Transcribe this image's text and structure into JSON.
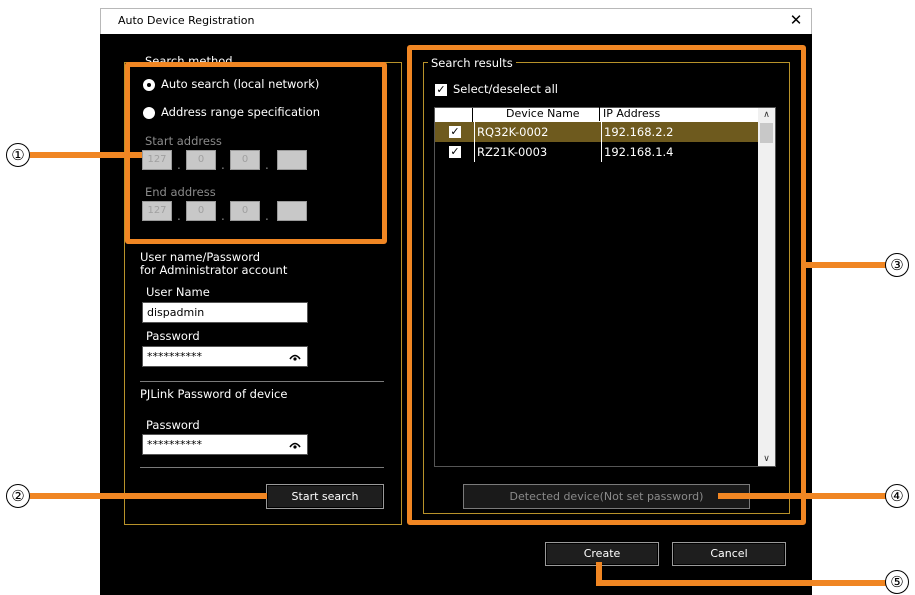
{
  "window": {
    "title": "Auto Device Registration",
    "close_glyph": "✕"
  },
  "search_method": {
    "group_label": "Search method",
    "option_auto": "Auto search (local network)",
    "option_range": "Address range specification",
    "start_label": "Start address",
    "end_label": "End address",
    "start_ip": [
      "127",
      "0",
      "0",
      ""
    ],
    "end_ip": [
      "127",
      "0",
      "0",
      ""
    ]
  },
  "admin": {
    "heading_line1": "User name/Password",
    "heading_line2": "for Administrator account",
    "username_label": "User Name",
    "username_value": "dispadmin",
    "password_label": "Password",
    "password_value": "**********"
  },
  "pjlink": {
    "heading": "PJLink Password of device",
    "password_label": "Password",
    "password_value": "**********"
  },
  "buttons": {
    "start_search": "Start search",
    "detected_device": "Detected device(Not set password)",
    "create": "Create",
    "cancel": "Cancel"
  },
  "results": {
    "group_label": "Search results",
    "select_all": "Select/deselect all",
    "columns": [
      "Device Name",
      "IP Address"
    ],
    "rows": [
      {
        "name": "RQ32K-0002",
        "ip": "192.168.2.2",
        "checked": true,
        "selected": true
      },
      {
        "name": "RZ21K-0003",
        "ip": "192.168.1.4",
        "checked": true,
        "selected": false
      }
    ]
  },
  "callouts": [
    "①",
    "②",
    "③",
    "④",
    "⑤"
  ],
  "colors": {
    "accent": "#f08623",
    "selected_row": "#6e5a1e",
    "group_border": "#b8922a"
  }
}
